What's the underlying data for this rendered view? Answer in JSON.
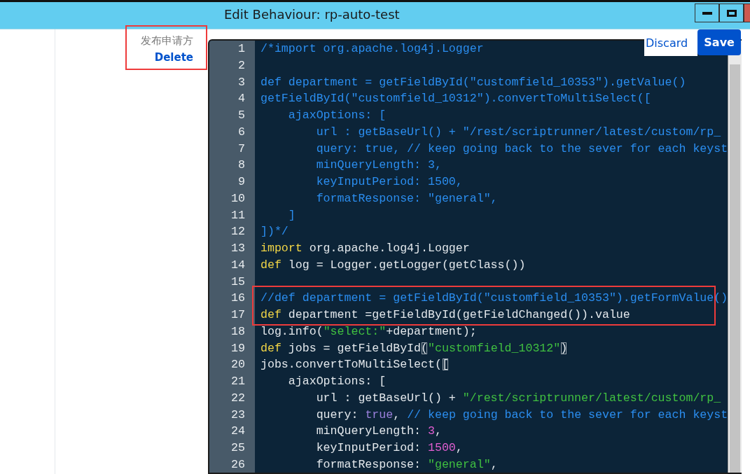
{
  "window": {
    "title": "Edit Behaviour: rp-auto-test",
    "controls": [
      {
        "kind": "minimize"
      },
      {
        "kind": "maximize"
      },
      {
        "kind": "close"
      }
    ]
  },
  "field": {
    "label": "发布申请方",
    "delete_link": "Delete",
    "annotated": true
  },
  "actions": {
    "discard": "Discard",
    "save": "Save"
  },
  "editor": {
    "lines": [
      {
        "number": "1",
        "boxed": false,
        "tokens": [
          {
            "kind": "comment",
            "text": "/*import org.apache.log4j.Logger"
          }
        ]
      },
      {
        "number": "2",
        "boxed": false
      },
      {
        "number": "3",
        "boxed": false,
        "tokens": [
          {
            "kind": "comment",
            "text": "def department = getFieldById(\"customfield_10353\").getValue()"
          }
        ]
      },
      {
        "number": "4",
        "boxed": false,
        "tokens": [
          {
            "kind": "comment",
            "text": "getFieldById(\"customfield_10312\").convertToMultiSelect(["
          }
        ]
      },
      {
        "number": "5",
        "boxed": false,
        "tokens": [
          {
            "kind": "comment",
            "text": "    ajaxOptions: ["
          }
        ]
      },
      {
        "number": "6",
        "boxed": false,
        "tokens": [
          {
            "kind": "comment",
            "text": "        url : getBaseUrl() + \"/rest/scriptrunner/latest/custom/rp_"
          }
        ]
      },
      {
        "number": "7",
        "boxed": false,
        "tokens": [
          {
            "kind": "comment",
            "text": "        query: true, // keep going back to the sever for each keyst"
          }
        ]
      },
      {
        "number": "8",
        "boxed": false,
        "tokens": [
          {
            "kind": "comment",
            "text": "        minQueryLength: 3,"
          }
        ]
      },
      {
        "number": "9",
        "boxed": false,
        "tokens": [
          {
            "kind": "comment",
            "text": "        keyInputPeriod: 1500,"
          }
        ]
      },
      {
        "number": "10",
        "boxed": false,
        "tokens": [
          {
            "kind": "comment",
            "text": "        formatResponse: \"general\","
          }
        ]
      },
      {
        "number": "11",
        "boxed": false,
        "tokens": [
          {
            "kind": "comment",
            "text": "    ]"
          }
        ]
      },
      {
        "number": "12",
        "boxed": false,
        "tokens": [
          {
            "kind": "comment",
            "text": "])*/"
          }
        ]
      },
      {
        "number": "13",
        "boxed": false,
        "tokens": [
          {
            "kind": "keyword",
            "text": "import"
          },
          {
            "kind": "plain",
            "text": " org.apache.log4j.Logger"
          }
        ]
      },
      {
        "number": "14",
        "boxed": false,
        "tokens": [
          {
            "kind": "keyword",
            "text": "def"
          },
          {
            "kind": "plain",
            "text": " log = Logger.getLogger(getClass())"
          }
        ]
      },
      {
        "number": "15",
        "boxed": false
      },
      {
        "number": "16",
        "boxed": true,
        "tokens": [
          {
            "kind": "comment",
            "text": "//def department = getFieldById(\"customfield_10353\").getFormValue()"
          }
        ]
      },
      {
        "number": "17",
        "boxed": true,
        "tokens": [
          {
            "kind": "keyword",
            "text": "def"
          },
          {
            "kind": "plain",
            "text": " department =getFieldById(getFieldChanged()).value"
          }
        ]
      },
      {
        "number": "18",
        "boxed": false,
        "tokens": [
          {
            "kind": "plain",
            "text": "log.info("
          },
          {
            "kind": "string",
            "text": "\"select:\""
          },
          {
            "kind": "plain",
            "text": "+department);"
          }
        ]
      },
      {
        "number": "19",
        "boxed": false,
        "tokens": [
          {
            "kind": "keyword",
            "text": "def"
          },
          {
            "kind": "plain",
            "text": " jobs = getFieldById"
          },
          {
            "kind": "bracket",
            "text": "("
          },
          {
            "kind": "string",
            "text": "\"customfield_10312\""
          },
          {
            "kind": "bracket",
            "text": ")"
          }
        ]
      },
      {
        "number": "20",
        "boxed": false,
        "tokens": [
          {
            "kind": "plain",
            "text": "jobs.convertToMultiSelect("
          },
          {
            "kind": "bracket",
            "text": "["
          }
        ]
      },
      {
        "number": "21",
        "boxed": false,
        "tokens": [
          {
            "kind": "plain",
            "text": "    ajaxOptions: ["
          }
        ]
      },
      {
        "number": "22",
        "boxed": false,
        "tokens": [
          {
            "kind": "plain",
            "text": "        url : getBaseUrl() + "
          },
          {
            "kind": "string",
            "text": "\"/rest/scriptrunner/latest/custom/rp_"
          }
        ]
      },
      {
        "number": "23",
        "boxed": false,
        "tokens": [
          {
            "kind": "plain",
            "text": "        query: "
          },
          {
            "kind": "bool",
            "text": "true"
          },
          {
            "kind": "plain",
            "text": ", "
          },
          {
            "kind": "comment",
            "text": "// keep going back to the sever for each keyst"
          }
        ]
      },
      {
        "number": "24",
        "boxed": false,
        "tokens": [
          {
            "kind": "plain",
            "text": "        minQueryLength: "
          },
          {
            "kind": "number",
            "text": "3"
          },
          {
            "kind": "plain",
            "text": ","
          }
        ]
      },
      {
        "number": "25",
        "boxed": false,
        "tokens": [
          {
            "kind": "plain",
            "text": "        keyInputPeriod: "
          },
          {
            "kind": "number",
            "text": "1500"
          },
          {
            "kind": "plain",
            "text": ","
          }
        ]
      },
      {
        "number": "26",
        "boxed": false,
        "tokens": [
          {
            "kind": "plain",
            "text": "        formatResponse: "
          },
          {
            "kind": "string",
            "text": "\"general\""
          },
          {
            "kind": "plain",
            "text": ","
          }
        ]
      }
    ]
  }
}
